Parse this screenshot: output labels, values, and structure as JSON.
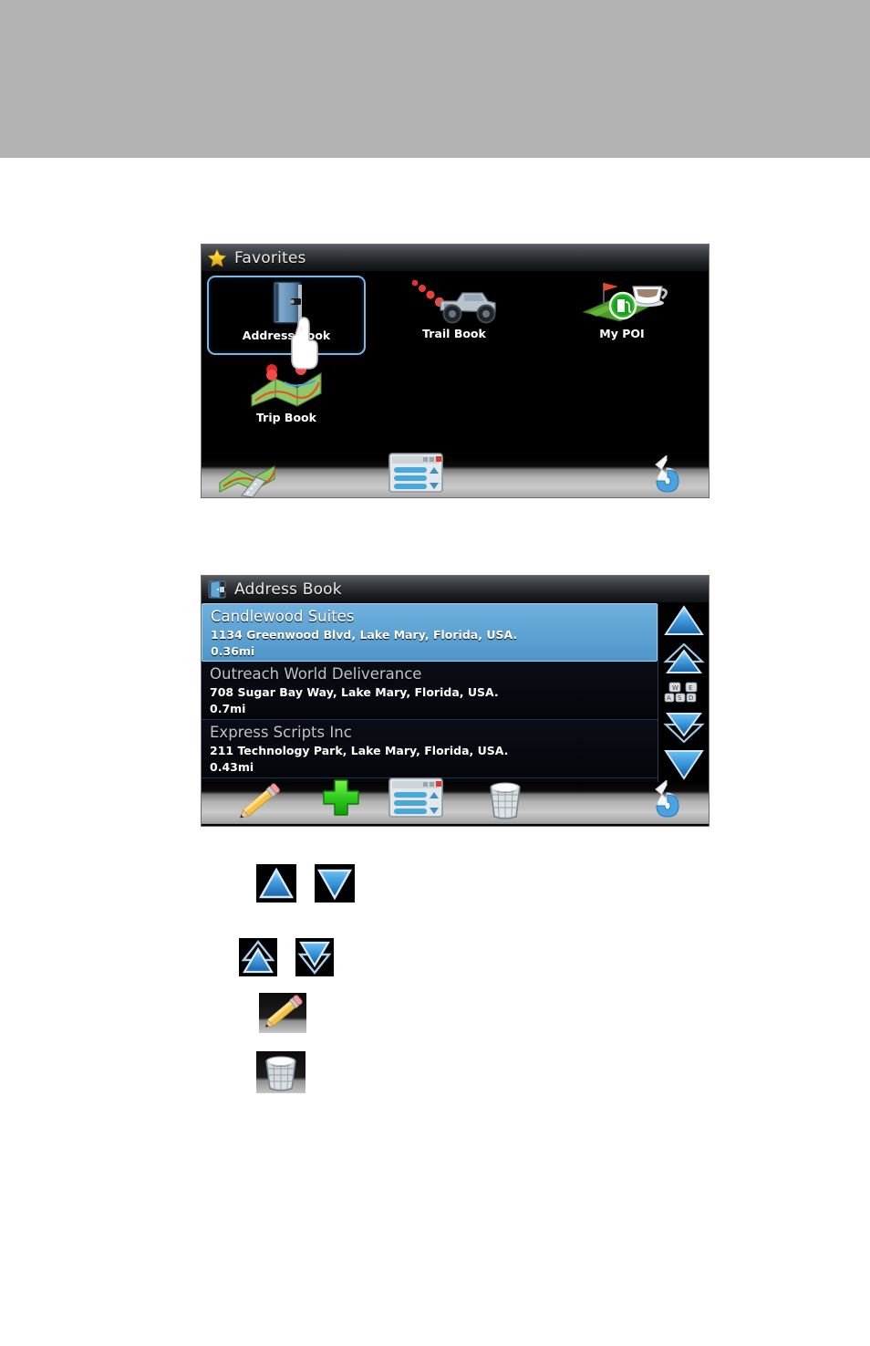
{
  "page": {
    "background": "#ffffff",
    "top_banner_color": "#b3b3b3"
  },
  "favorites_screen": {
    "title": "Favorites",
    "title_icon": "star-icon",
    "items": [
      {
        "label": "Address Book",
        "icon": "blue-book-icon",
        "selected": true
      },
      {
        "label": "Trail Book",
        "icon": "offroad-truck-icon",
        "selected": false
      },
      {
        "label": "My POI",
        "icon": "poi-flag-coffee-icon",
        "selected": false
      },
      {
        "label": "Trip Book",
        "icon": "folded-map-pins-icon",
        "selected": false
      }
    ],
    "cursor": "hand-pointer-icon",
    "toolbar": [
      {
        "name": "map-button",
        "icon": "map-road-icon"
      },
      {
        "name": "menu-list-button",
        "icon": "list-window-icon"
      },
      {
        "name": "back-button",
        "icon": "blue-return-arrow-icon"
      }
    ]
  },
  "address_book_screen": {
    "title": "Address Book",
    "title_icon": "open-door-icon",
    "entries": [
      {
        "name": "Candlewood Suites",
        "address": "1134 Greenwood Blvd, Lake Mary, Florida, USA.",
        "distance": "0.36mi",
        "selected": true
      },
      {
        "name": "Outreach World Deliverance",
        "address": "708 Sugar Bay Way, Lake Mary, Florida, USA.",
        "distance": "0.7mi",
        "selected": false
      },
      {
        "name": "Express Scripts Inc",
        "address": "211 Technology Park, Lake Mary, Florida, USA.",
        "distance": "0.43mi",
        "selected": false
      }
    ],
    "scrollbar": [
      {
        "name": "scroll-up-button",
        "icon": "triangle-up-icon"
      },
      {
        "name": "page-up-button",
        "icon": "double-triangle-up-icon"
      },
      {
        "name": "keyboard-button",
        "icon": "keyboard-icon"
      },
      {
        "name": "page-down-button",
        "icon": "double-triangle-down-icon"
      },
      {
        "name": "scroll-down-button",
        "icon": "triangle-down-icon"
      }
    ],
    "toolbar": [
      {
        "name": "edit-button",
        "icon": "pencil-icon"
      },
      {
        "name": "add-button",
        "icon": "green-plus-icon"
      },
      {
        "name": "menu-list-button",
        "icon": "list-window-icon"
      },
      {
        "name": "delete-button",
        "icon": "trash-can-icon"
      },
      {
        "name": "back-button",
        "icon": "blue-return-arrow-icon"
      }
    ]
  },
  "legend": {
    "icons": [
      {
        "name": "scroll-up-icon",
        "icon": "triangle-up-icon"
      },
      {
        "name": "scroll-down-icon",
        "icon": "triangle-down-icon"
      },
      {
        "name": "page-up-icon",
        "icon": "double-triangle-up-icon"
      },
      {
        "name": "page-down-icon",
        "icon": "double-triangle-down-icon"
      },
      {
        "name": "edit-icon",
        "icon": "pencil-icon"
      },
      {
        "name": "delete-icon",
        "icon": "trash-can-icon"
      }
    ]
  },
  "colors": {
    "selection_blue": "#5ba3d6",
    "highlight_border": "#7ab8e8",
    "panel_black": "#000000",
    "shelf_gray": "#b4b4b4"
  }
}
